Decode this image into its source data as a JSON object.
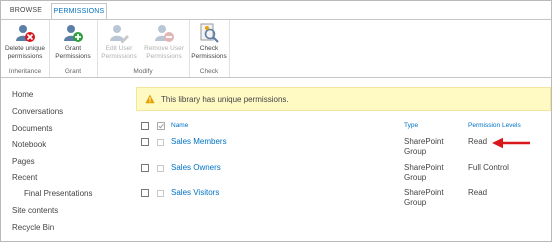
{
  "ribbon": {
    "tabs": [
      {
        "label": "BROWSE",
        "active": false
      },
      {
        "label": "PERMISSIONS",
        "active": true
      }
    ],
    "groups": [
      {
        "label": "Inheritance",
        "buttons": [
          {
            "label": "Delete unique permissions",
            "icon": "delete-permissions-icon",
            "enabled": true
          }
        ]
      },
      {
        "label": "Grant",
        "buttons": [
          {
            "label": "Grant Permissions",
            "icon": "grant-permissions-icon",
            "enabled": true
          }
        ]
      },
      {
        "label": "Modify",
        "buttons": [
          {
            "label": "Edit User Permissions",
            "icon": "edit-permissions-icon",
            "enabled": false
          },
          {
            "label": "Remove User Permissions",
            "icon": "remove-permissions-icon",
            "enabled": false
          }
        ]
      },
      {
        "label": "Check",
        "buttons": [
          {
            "label": "Check Permissions",
            "icon": "check-permissions-icon",
            "enabled": true
          }
        ]
      }
    ]
  },
  "nav": {
    "items": [
      "Home",
      "Conversations",
      "Documents",
      "Notebook",
      "Pages",
      "Recent",
      "Final Presentations",
      "Site contents",
      "Recycle Bin"
    ]
  },
  "banner": {
    "text": "This library has unique permissions.",
    "icon": "warning-icon"
  },
  "table": {
    "headers": {
      "name": "Name",
      "type": "Type",
      "level": "Permission Levels"
    },
    "rows": [
      {
        "name": "Sales Members",
        "type": "SharePoint Group",
        "level": "Read"
      },
      {
        "name": "Sales Owners",
        "type": "SharePoint Group",
        "level": "Full Control"
      },
      {
        "name": "Sales Visitors",
        "type": "SharePoint Group",
        "level": "Read"
      }
    ]
  },
  "colors": {
    "accent": "#0072c6",
    "banner_bg": "#fff9c4",
    "arrow": "#d9161c"
  }
}
